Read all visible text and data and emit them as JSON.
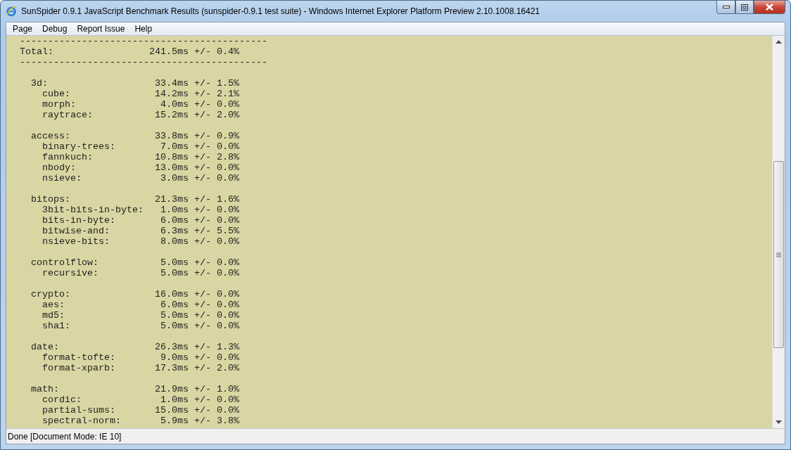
{
  "window": {
    "title": "SunSpider 0.9.1 JavaScript Benchmark Results (sunspider-0.9.1 test suite) - Windows Internet Explorer Platform Preview 2.10.1008.16421"
  },
  "menu": [
    "Page",
    "Debug",
    "Report Issue",
    "Help"
  ],
  "report": {
    "separator_top": "--------------------------------------------",
    "total": {
      "label": "Total:",
      "value": "241.5ms +/- 0.4%"
    },
    "separator_bottom": "--------------------------------------------",
    "groups": [
      {
        "name": "3d:",
        "value": "33.4ms +/- 1.5%",
        "children": [
          {
            "name": "cube:",
            "value": "14.2ms +/- 2.1%"
          },
          {
            "name": "morph:",
            "value": "4.0ms +/- 0.0%"
          },
          {
            "name": "raytrace:",
            "value": "15.2ms +/- 2.0%"
          }
        ]
      },
      {
        "name": "access:",
        "value": "33.8ms +/- 0.9%",
        "children": [
          {
            "name": "binary-trees:",
            "value": "7.0ms +/- 0.0%"
          },
          {
            "name": "fannkuch:",
            "value": "10.8ms +/- 2.8%"
          },
          {
            "name": "nbody:",
            "value": "13.0ms +/- 0.0%"
          },
          {
            "name": "nsieve:",
            "value": "3.0ms +/- 0.0%"
          }
        ]
      },
      {
        "name": "bitops:",
        "value": "21.3ms +/- 1.6%",
        "children": [
          {
            "name": "3bit-bits-in-byte:",
            "value": "1.0ms +/- 0.0%"
          },
          {
            "name": "bits-in-byte:",
            "value": "6.0ms +/- 0.0%"
          },
          {
            "name": "bitwise-and:",
            "value": "6.3ms +/- 5.5%"
          },
          {
            "name": "nsieve-bits:",
            "value": "8.0ms +/- 0.0%"
          }
        ]
      },
      {
        "name": "controlflow:",
        "value": "5.0ms +/- 0.0%",
        "children": [
          {
            "name": "recursive:",
            "value": "5.0ms +/- 0.0%"
          }
        ]
      },
      {
        "name": "crypto:",
        "value": "16.0ms +/- 0.0%",
        "children": [
          {
            "name": "aes:",
            "value": "6.0ms +/- 0.0%"
          },
          {
            "name": "md5:",
            "value": "5.0ms +/- 0.0%"
          },
          {
            "name": "sha1:",
            "value": "5.0ms +/- 0.0%"
          }
        ]
      },
      {
        "name": "date:",
        "value": "26.3ms +/- 1.3%",
        "children": [
          {
            "name": "format-tofte:",
            "value": "9.0ms +/- 0.0%"
          },
          {
            "name": "format-xparb:",
            "value": "17.3ms +/- 2.0%"
          }
        ]
      },
      {
        "name": "math:",
        "value": "21.9ms +/- 1.0%",
        "children": [
          {
            "name": "cordic:",
            "value": "1.0ms +/- 0.0%"
          },
          {
            "name": "partial-sums:",
            "value": "15.0ms +/- 0.0%"
          },
          {
            "name": "spectral-norm:",
            "value": "5.9ms +/- 3.8%"
          }
        ]
      }
    ]
  },
  "status_bar": "Done [Document Mode: IE 10]"
}
